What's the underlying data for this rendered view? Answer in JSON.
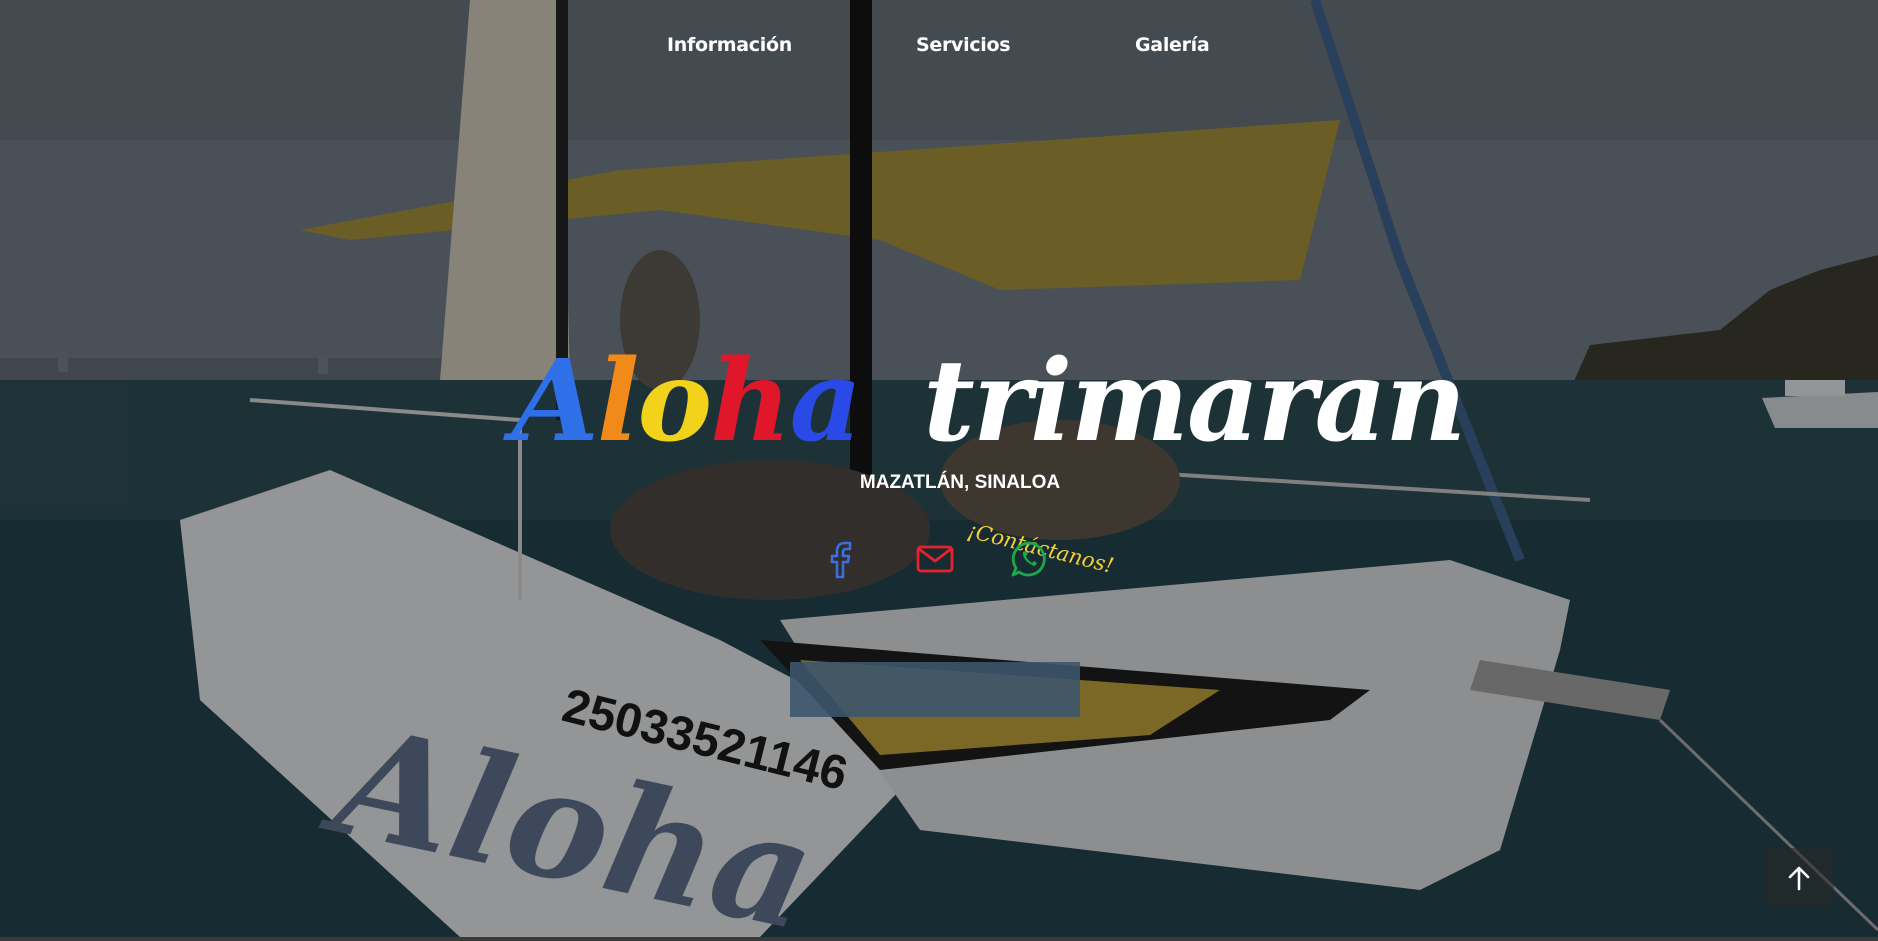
{
  "nav": {
    "items": [
      {
        "label": "Información"
      },
      {
        "label": "Servicios"
      },
      {
        "label": "Galería"
      }
    ]
  },
  "hero": {
    "title_part1": [
      "A",
      "l",
      "o",
      "h",
      "a"
    ],
    "title_part1_colors": [
      "#2f6fe8",
      "#f28a1a",
      "#f2d21a",
      "#e0162b",
      "#2a4ae8"
    ],
    "title_part2": "trimaran",
    "title_part2_color": "#ffffff",
    "subtitle": "MAZATLÁN, SINALOA",
    "contact_label": "¡Contáctanos!",
    "contact_label_color": "#f7d035",
    "boat_number": "25033521146",
    "boat_name": "Aloha"
  },
  "social": [
    {
      "name": "facebook-icon",
      "color": "#3b6fe0"
    },
    {
      "name": "mail-icon",
      "color": "#e8212b"
    },
    {
      "name": "whatsapp-icon",
      "color": "#1aa84a"
    }
  ],
  "scroll_top": {
    "icon": "arrow-up-icon"
  }
}
